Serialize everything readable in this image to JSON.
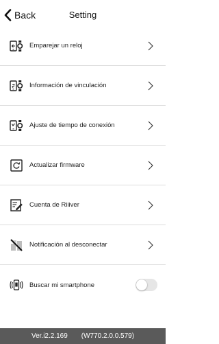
{
  "header": {
    "back_label": "Back",
    "title": "Setting"
  },
  "menu": {
    "items": [
      {
        "label": "Emparejar un reloj",
        "icon": "phone-watch-pair-icon",
        "control": "chevron"
      },
      {
        "label": "Información de vinculación",
        "icon": "phone-watch-link-icon",
        "control": "chevron"
      },
      {
        "label": "Ajuste de tiempo de conexión",
        "icon": "phone-watch-time-icon",
        "control": "chevron"
      },
      {
        "label": "Actualizar firmware",
        "icon": "refresh-icon",
        "control": "chevron"
      },
      {
        "label": "Cuenta de Riiiver",
        "icon": "edit-document-icon",
        "control": "chevron"
      },
      {
        "label": "Notificación al desconectar",
        "icon": "disconnect-notification-icon",
        "control": "chevron"
      },
      {
        "label": "Buscar mi smartphone",
        "icon": "find-phone-icon",
        "control": "toggle",
        "toggle_on": false
      }
    ],
    "chevron_glyph": ">"
  },
  "footer": {
    "app_version": "Ver.i2.2.169",
    "watch_version": "(W770.2.0.0.579)"
  },
  "colors": {
    "footer_bg": "#5a5a5a",
    "divider": "#dcdcdc",
    "toggle_off": "#e6e6e6"
  }
}
